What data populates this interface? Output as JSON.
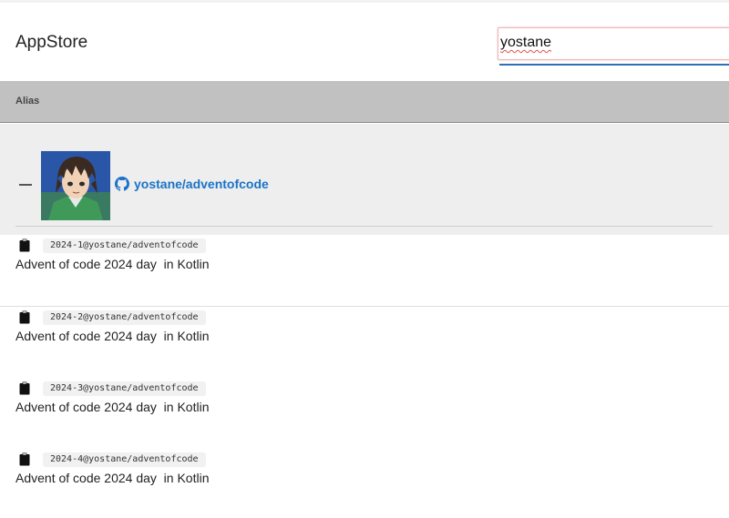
{
  "app": {
    "title": "AppStore"
  },
  "search": {
    "value": "yostane"
  },
  "table": {
    "column_alias": "Alias"
  },
  "group": {
    "repo": "yostane/adventofcode"
  },
  "items": [
    {
      "id": "2024-1@yostane/adventofcode",
      "description": "Advent of code 2024 day  in Kotlin"
    },
    {
      "id": "2024-2@yostane/adventofcode",
      "description": "Advent of code 2024 day  in Kotlin"
    },
    {
      "id": "2024-3@yostane/adventofcode",
      "description": "Advent of code 2024 day  in Kotlin"
    },
    {
      "id": "2024-4@yostane/adventofcode",
      "description": "Advent of code 2024 day  in Kotlin"
    }
  ],
  "icons": {
    "collapse": "minus-icon",
    "repo": "github-icon",
    "item": "clipboard-icon"
  },
  "colors": {
    "link": "#1a73c7",
    "header_bg": "#c1c1c1",
    "group_bg": "#eeeeee",
    "search_accent": "#2f6fb7"
  }
}
